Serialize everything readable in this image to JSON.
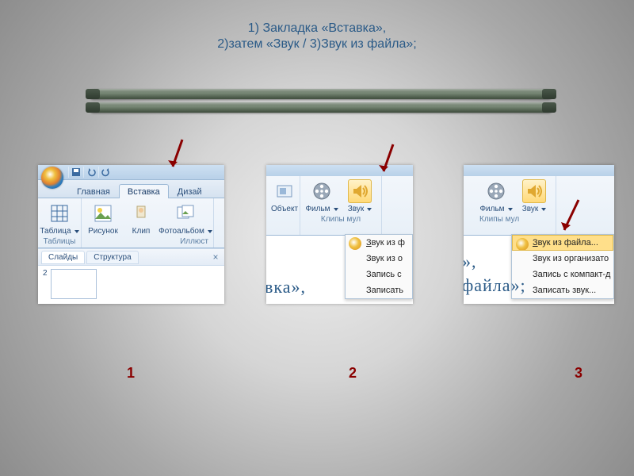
{
  "title": {
    "line1": "1) Закладка «Вставка»,",
    "line2": "2)затем «Звук / 3)Звук из файла»;"
  },
  "labels": {
    "n1": "1",
    "n2": "2",
    "n3": "3"
  },
  "shot1": {
    "tabs": {
      "home": "Главная",
      "insert": "Вставка",
      "design": "Дизай"
    },
    "ribbon": {
      "table": "Таблица",
      "picture": "Рисунок",
      "clip": "Клип",
      "album": "Фотоальбом"
    },
    "groups": {
      "tables": "Таблицы",
      "illus": "Иллюст"
    },
    "pane": {
      "slides": "Слайды",
      "outline": "Структура",
      "close": "×"
    },
    "slide_num": "2"
  },
  "shot2": {
    "ribbon": {
      "object": "Объект",
      "movie": "Фильм",
      "sound": "Звук"
    },
    "group": "Клипы мул",
    "menu": {
      "i1_pre": "З",
      "i1_post": "вук из ф",
      "i2": "Звук из о",
      "i3": "Запись с",
      "i4": "Записать"
    },
    "bigtxt": "вка»,"
  },
  "shot3": {
    "ribbon": {
      "movie": "Фильм",
      "sound": "Звук"
    },
    "group": "Клипы мул",
    "menu": {
      "i1_pre": "З",
      "i1_post": "вук из файла...",
      "i2": "Звук из организато",
      "i3": "Запись с компакт-д",
      "i4": "Записать звук..."
    },
    "bigtxt1": "»,",
    "bigtxt2": "файла»;"
  }
}
